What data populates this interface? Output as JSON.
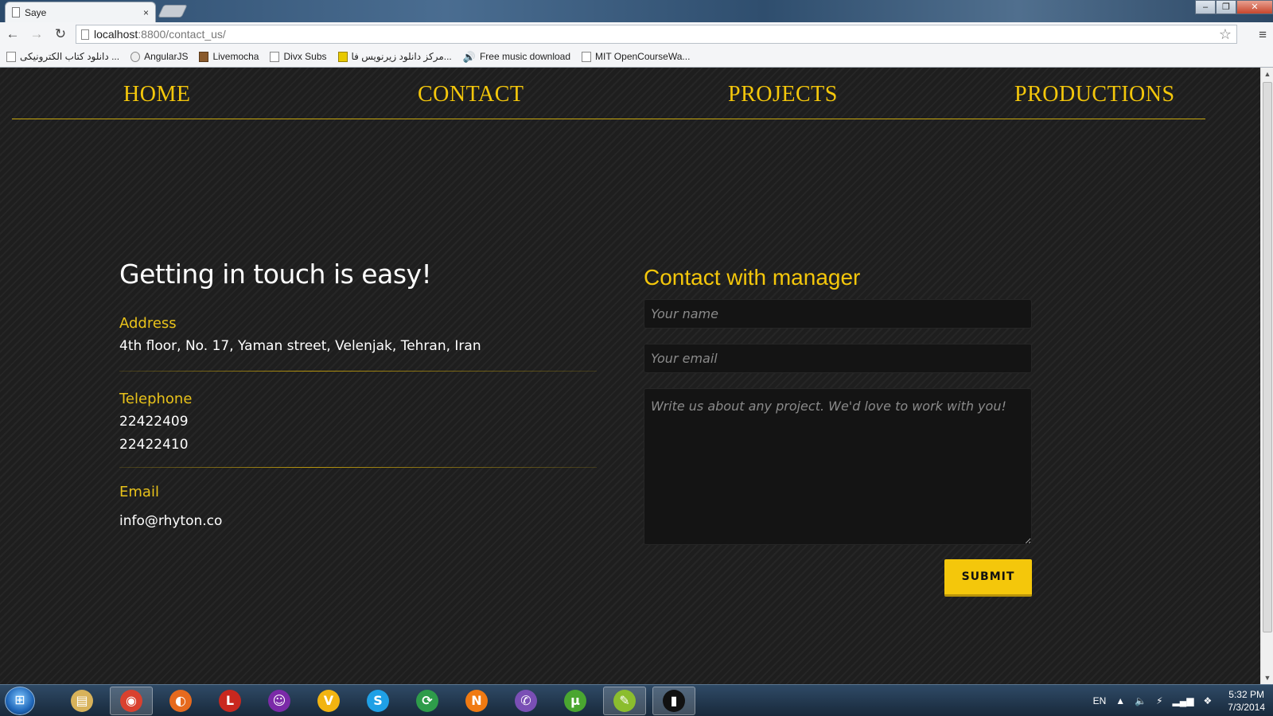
{
  "browser": {
    "tab_title": "Saye",
    "tab_close": "×",
    "url_host": "localhost",
    "url_path": ":8800/contact_us/",
    "nav_back": "←",
    "nav_forward": "→",
    "nav_reload": "↻",
    "star": "☆",
    "menu": "≡",
    "window_minimize": "–",
    "window_restore": "❐",
    "window_close": "✕",
    "bookmarks": [
      {
        "label": "دانلود کتاب الکترونیکی ..."
      },
      {
        "label": "AngularJS"
      },
      {
        "label": "Livemocha"
      },
      {
        "label": "Divx Subs"
      },
      {
        "label": "مرکز دانلود زیرنویس فا..."
      },
      {
        "label": "Free music download"
      },
      {
        "label": "MIT OpenCourseWa..."
      }
    ]
  },
  "site_nav": {
    "home": "HOME",
    "contact": "CONTACT",
    "projects": "PROJECTS",
    "productions": "PRODUCTIONS"
  },
  "contact_info": {
    "heading": "Getting in touch is easy!",
    "address_label": "Address",
    "address_value": "4th floor, No. 17, Yaman street, Velenjak, Tehran, Iran",
    "telephone_label": "Telephone",
    "telephone_1": "22422409",
    "telephone_2": "22422410",
    "email_label": "Email",
    "email_value": "info@rhyton.co"
  },
  "form": {
    "title": "Contact with manager",
    "name_placeholder": "Your name",
    "email_placeholder": "Your email",
    "message_placeholder": "Write us about any project. We'd love to work with you!",
    "submit_label": "SUBMIT"
  },
  "taskbar": {
    "lang": "EN",
    "time": "5:32 PM",
    "date": "7/3/2014",
    "icons": [
      {
        "name": "explorer-icon",
        "glyph": "▤",
        "color": "#d8b25a"
      },
      {
        "name": "chrome-icon",
        "glyph": "◉",
        "color": "#d9412f"
      },
      {
        "name": "firefox-icon",
        "glyph": "◐",
        "color": "#e66a1e"
      },
      {
        "name": "ldoce-icon",
        "glyph": "L",
        "color": "#c9281f"
      },
      {
        "name": "yahoo-messenger-icon",
        "glyph": "☺",
        "color": "#7b2aa8"
      },
      {
        "name": "v-app-icon",
        "glyph": "V",
        "color": "#f2b411"
      },
      {
        "name": "skype-icon",
        "glyph": "S",
        "color": "#1fa0e6"
      },
      {
        "name": "network-app-icon",
        "glyph": "⟳",
        "color": "#2e9c4a"
      },
      {
        "name": "n-app-icon",
        "glyph": "N",
        "color": "#f07a12"
      },
      {
        "name": "viber-icon",
        "glyph": "✆",
        "color": "#7a4fb5"
      },
      {
        "name": "utorrent-icon",
        "glyph": "µ",
        "color": "#4aa630"
      },
      {
        "name": "editor-icon",
        "glyph": "✎",
        "color": "#8bbd2e"
      },
      {
        "name": "cmd-icon",
        "glyph": "▮",
        "color": "#111111"
      }
    ]
  }
}
